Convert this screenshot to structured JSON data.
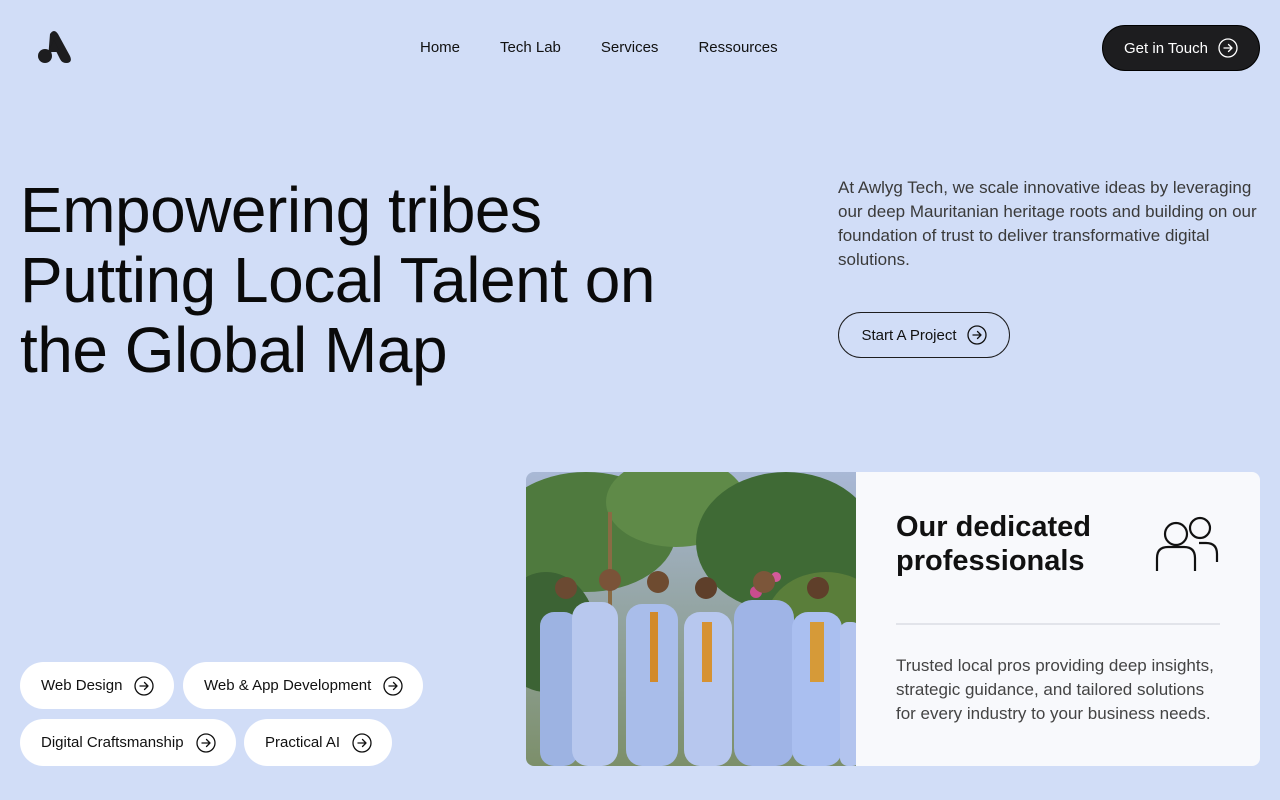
{
  "header": {
    "logo": "awlyg-logo-icon",
    "nav": [
      {
        "label": "Home"
      },
      {
        "label": "Tech Lab"
      },
      {
        "label": "Services"
      },
      {
        "label": "Ressources"
      }
    ],
    "cta_label": "Get in Touch"
  },
  "hero": {
    "headline": [
      "Empowering tribes",
      "Putting Local Talent on",
      "the Global Map"
    ],
    "intro": "At Awlyg Tech, we scale innovative ideas by leveraging our deep Mauritanian heritage roots and building on our foundation of trust to deliver transformative digital solutions.",
    "start_label": "Start A Project"
  },
  "services": [
    {
      "label": "Web Design"
    },
    {
      "label": "Web & App Development"
    },
    {
      "label": "Digital Craftsmanship"
    },
    {
      "label": "Practical AI"
    }
  ],
  "card": {
    "title": [
      "Our dedicated",
      "professionals"
    ],
    "icon": "people-icon",
    "text": "Trusted local pros providing deep insights, strategic guidance, and tailored solutions for every industry to your business needs."
  },
  "colors": {
    "background": "#d1ddf7",
    "dark_button": "#1d1d1f",
    "card": "#f8f9fc",
    "pill": "#ffffff"
  }
}
